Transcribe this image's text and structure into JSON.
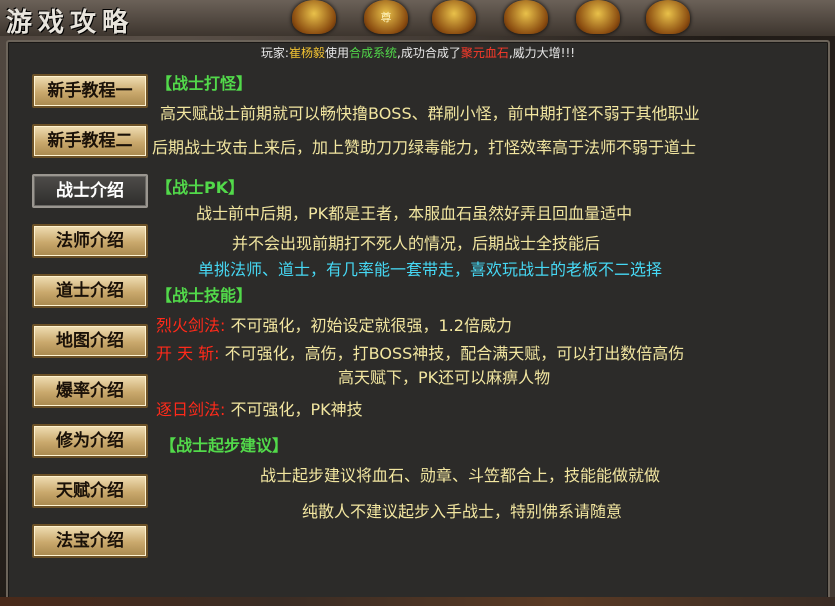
{
  "window": {
    "title": "游戏攻略"
  },
  "topbar": {
    "badge_label": "尊"
  },
  "ticker": {
    "prefix": "玩家:",
    "player": "崔杨毅",
    "mid1": "使用",
    "system": "合成系统",
    "mid2": ",成功合成了",
    "item": "聚元血石",
    "suffix": ",威力大增!!!"
  },
  "nav": {
    "items": [
      {
        "label": "新手教程一"
      },
      {
        "label": "新手教程二"
      },
      {
        "label": "战士介绍"
      },
      {
        "label": "法师介绍"
      },
      {
        "label": "道士介绍"
      },
      {
        "label": "地图介绍"
      },
      {
        "label": "爆率介绍"
      },
      {
        "label": "修为介绍"
      },
      {
        "label": "天赋介绍"
      },
      {
        "label": "法宝介绍"
      }
    ],
    "active_index": 2
  },
  "content": {
    "s1_title": "【战士打怪】",
    "s1_l1": "高天赋战士前期就可以畅快撸BOSS、群刷小怪，前中期打怪不弱于其他职业",
    "s1_l2": "后期战士攻击上来后，加上赞助刀刀绿毒能力，打怪效率高于法师不弱于道士",
    "s2_title": "【战士PK】",
    "s2_l1": "战士前中后期，PK都是王者，本服血石虽然好弄且回血量适中",
    "s2_l2": "并不会出现前期打不死人的情况，后期战士全技能后",
    "s2_l3": "单挑法师、道士，有几率能一套带走，喜欢玩战士的老板不二选择",
    "s3_title": "【战士技能】",
    "skill1_name": "烈火剑法:",
    "skill1_desc": " 不可强化，初始设定就很强，1.2倍威力",
    "skill2_name": "开 天 斩:",
    "skill2_desc": " 不可强化，高伤，打BOSS神技，配合满天赋，可以打出数倍高伤",
    "skill2_cont": "高天赋下，PK还可以麻痹人物",
    "skill3_name": "逐日剑法:",
    "skill3_desc": " 不可强化，PK神技",
    "s4_title": "【战士起步建议】",
    "s4_l1": "战士起步建议将血石、勋章、斗笠都合上，技能能做就做",
    "s4_l2": "纯散人不建议起步入手战士，特别佛系请随意"
  }
}
